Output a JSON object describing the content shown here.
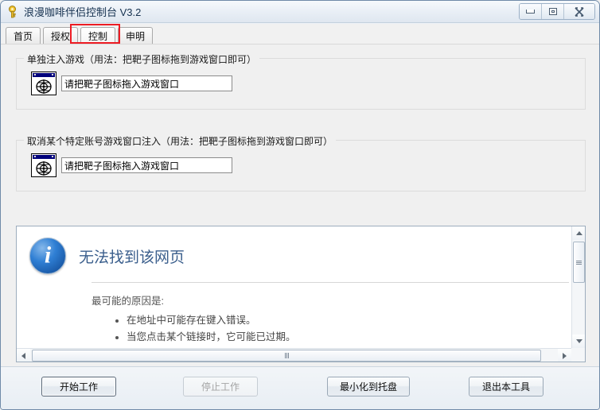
{
  "window": {
    "title": "浪漫咖啡伴侣控制台 V3.2",
    "icon": "key-icon",
    "controls": {
      "minimize": "minimize-icon",
      "maximize": "maximize-icon",
      "close": "close-icon"
    }
  },
  "tabs": [
    {
      "label": "首页",
      "active": false
    },
    {
      "label": "授权",
      "active": false
    },
    {
      "label": "控制",
      "active": true
    },
    {
      "label": "申明",
      "active": false
    }
  ],
  "annotation": {
    "highlight_color": "#ed1c24",
    "target_tab": "控制"
  },
  "groups": [
    {
      "title": "单独注入游戏（用法：把靶子图标拖到游戏窗口即可）",
      "icon": "target-window-icon",
      "field_value": "请把靶子图标拖入游戏窗口"
    },
    {
      "title": "取消某个特定账号游戏窗口注入（用法：把靶子图标拖到游戏窗口即可）",
      "icon": "target-window-icon",
      "field_value": "请把靶子图标拖入游戏窗口"
    }
  ],
  "browser": {
    "error_icon": "info-icon",
    "error_title": "无法找到该网页",
    "reason_heading": "最可能的原因是:",
    "reasons": [
      "在地址中可能存在键入错误。",
      "当您点击某个链接时，它可能已过期。"
    ],
    "scrollbars": {
      "vertical": "vertical-scrollbar",
      "horizontal": "horizontal-scrollbar"
    }
  },
  "buttons": [
    {
      "label": "开始工作",
      "state": "focused"
    },
    {
      "label": "停止工作",
      "state": "disabled"
    },
    {
      "label": "最小化到托盘",
      "state": "normal"
    },
    {
      "label": "退出本工具",
      "state": "normal"
    }
  ],
  "colors": {
    "accent_blue": "#00007b",
    "error_title_blue": "#3a5e8c",
    "highlight_red": "#ed1c24",
    "window_bg": "#f0f0f0"
  }
}
